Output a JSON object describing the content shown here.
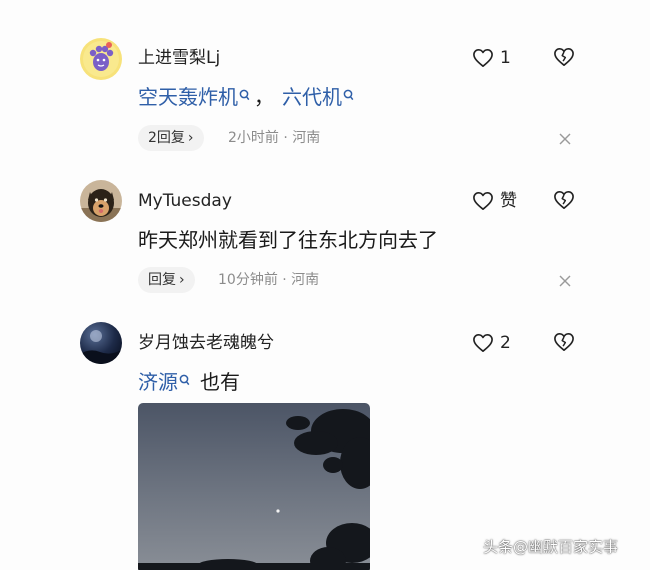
{
  "comments": [
    {
      "username": "上进雪梨Lj",
      "like_count": "1",
      "content": {
        "link1": "空天轰炸机",
        "sep": "，",
        "link2": "六代机"
      },
      "reply_label": "2回复",
      "meta": "2小时前 · 河南"
    },
    {
      "username": "MyTuesday",
      "like_label": "赞",
      "content": "昨天郑州就看到了往东北方向去了",
      "reply_label": "回复",
      "meta": "10分钟前 · 河南"
    },
    {
      "username": "岁月蚀去老魂魄兮",
      "like_count": "2",
      "content": {
        "link": "济源",
        "text": "也有"
      }
    }
  ],
  "watermark": {
    "prefix": "头条",
    "text": "@幽默百家实事"
  },
  "icons": [
    "heart-icon",
    "broken-heart-icon",
    "search-icon",
    "chevron-right-icon",
    "close-icon"
  ],
  "colors": {
    "link": "#2f5fa8",
    "meta": "#8c8c8c",
    "pill": "#f2f2f2"
  }
}
